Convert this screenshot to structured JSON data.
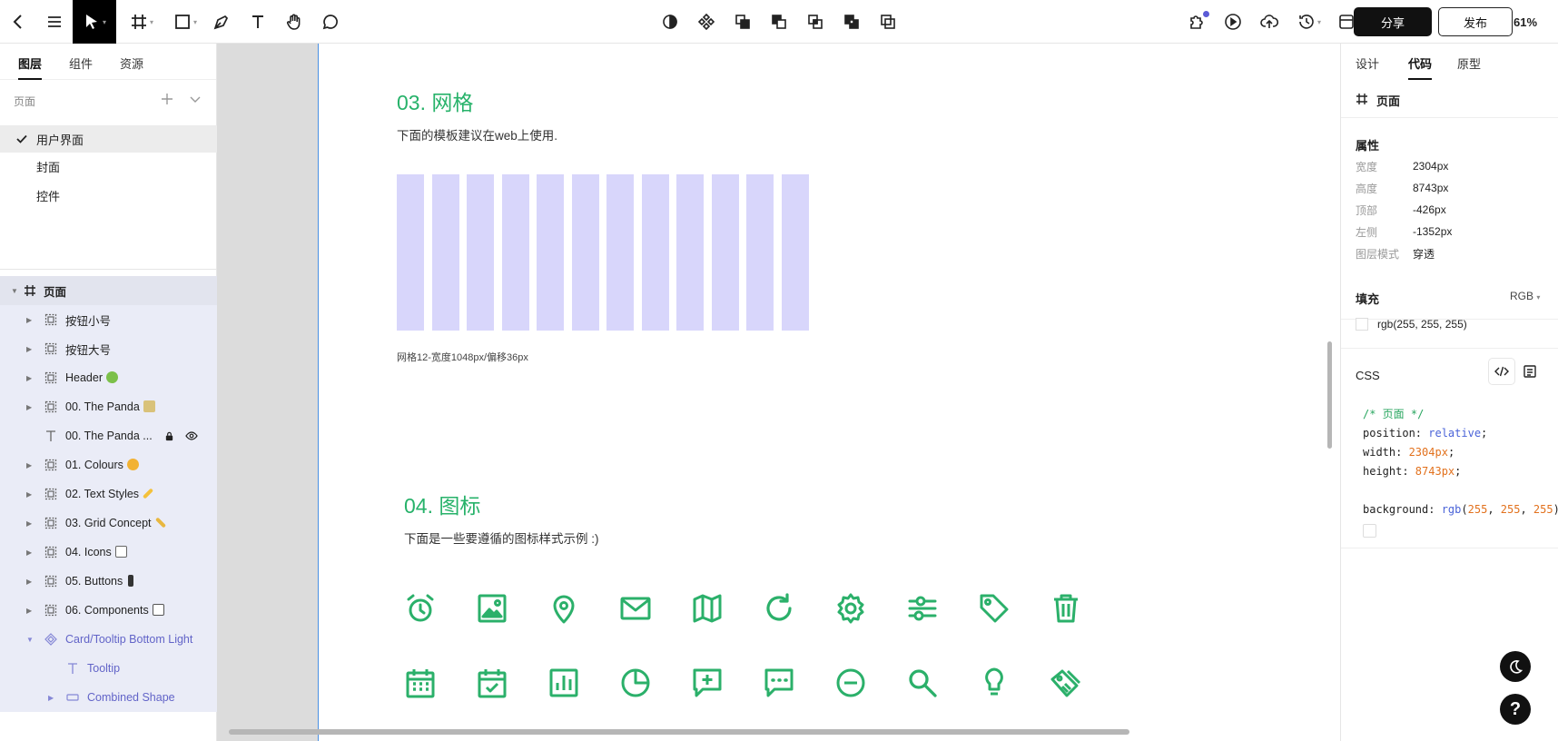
{
  "toolbar": {
    "zoom": "61%",
    "share_label": "分享",
    "publish_label": "发布",
    "left_tools": [
      "back-icon",
      "menu-icon",
      "move-tool-icon",
      "frame-tool-icon",
      "rectangle-tool-icon",
      "pen-tool-icon",
      "text-tool-icon",
      "hand-tool-icon",
      "comment-tool-icon"
    ],
    "center_tools": [
      "mask-icon",
      "component-icon",
      "boolean-union-icon",
      "boolean-subtract-icon",
      "boolean-intersect-icon",
      "boolean-exclude-icon",
      "flatten-icon"
    ],
    "right_tools": [
      "plugins-icon",
      "play-icon",
      "upload-icon",
      "history-icon",
      "layout-icon"
    ],
    "accent": "#5b5bd6"
  },
  "left_panel": {
    "tabs": [
      {
        "label": "图层"
      },
      {
        "label": "组件"
      },
      {
        "label": "资源"
      }
    ],
    "pages_label": "页面",
    "pages": [
      {
        "label": "用户界面",
        "selected": true
      },
      {
        "label": "封面"
      },
      {
        "label": "控件"
      }
    ],
    "layers": [
      {
        "name": "页面"
      },
      {
        "name": "按钮小号"
      },
      {
        "name": "按钮大号"
      },
      {
        "name": "Header"
      },
      {
        "name": "00. The Panda"
      },
      {
        "name": "00. The Panda ..."
      },
      {
        "name": "01. Colours"
      },
      {
        "name": "02. Text Styles"
      },
      {
        "name": "03. Grid Concept"
      },
      {
        "name": "04. Icons"
      },
      {
        "name": "05. Buttons"
      },
      {
        "name": "06. Components"
      },
      {
        "name": "Card/Tooltip Bottom Light"
      },
      {
        "name": "Tooltip"
      },
      {
        "name": "Combined Shape"
      }
    ]
  },
  "canvas": {
    "grid_section": {
      "title": "03. 网格",
      "desc": "下面的模板建议在web上使用.",
      "caption": "网格12-宽度1048px/偏移36px",
      "column_count": 12,
      "column_color": "#d8d6fb"
    },
    "icons_section": {
      "title": "04. 图标",
      "desc": "下面是一些要遵循的图标样式示例 :)",
      "row1": [
        "alarm-clock-icon",
        "image-icon",
        "location-pin-icon",
        "mail-icon",
        "map-icon",
        "refresh-icon",
        "settings-gear-icon",
        "sliders-icon",
        "tag-icon",
        "trash-icon"
      ],
      "row2": [
        "calendar-icon",
        "calendar-check-icon",
        "bar-chart-icon",
        "pie-chart-icon",
        "message-add-icon",
        "message-dots-icon",
        "minus-circle-icon",
        "search-icon",
        "lightbulb-icon",
        "price-tags-icon"
      ],
      "icon_color": "#2bb06a"
    }
  },
  "right_panel": {
    "tabs": [
      {
        "label": "设计"
      },
      {
        "label": "代码"
      },
      {
        "label": "原型"
      }
    ],
    "frame_name": "页面",
    "props_title": "属性",
    "props": [
      {
        "k": "宽度",
        "v": "2304px"
      },
      {
        "k": "高度",
        "v": "8743px"
      },
      {
        "k": "顶部",
        "v": "-426px"
      },
      {
        "k": "左侧",
        "v": "-1352px"
      },
      {
        "k": "图层模式",
        "v": "穿透"
      }
    ],
    "fill_title": "填充",
    "fill_mode": "RGB",
    "fill_value": "rgb(255, 255, 255)",
    "css_title": "CSS",
    "css": {
      "comment": "/* 页面 */",
      "l1_prop": "position: ",
      "l1_val": "relative",
      "l1_end": ";",
      "l2_prop": "width: ",
      "l2_val": "2304px",
      "l2_end": ";",
      "l3_prop": "height: ",
      "l3_val": "8743px",
      "l3_end": ";",
      "l4_prop": "background: ",
      "l4_fn": "rgb",
      "l4_open": "(",
      "l4_r": "255",
      "l4_c1": ", ",
      "l4_g": "255",
      "l4_c2": ", ",
      "l4_b": "255",
      "l4_end": ");"
    }
  }
}
